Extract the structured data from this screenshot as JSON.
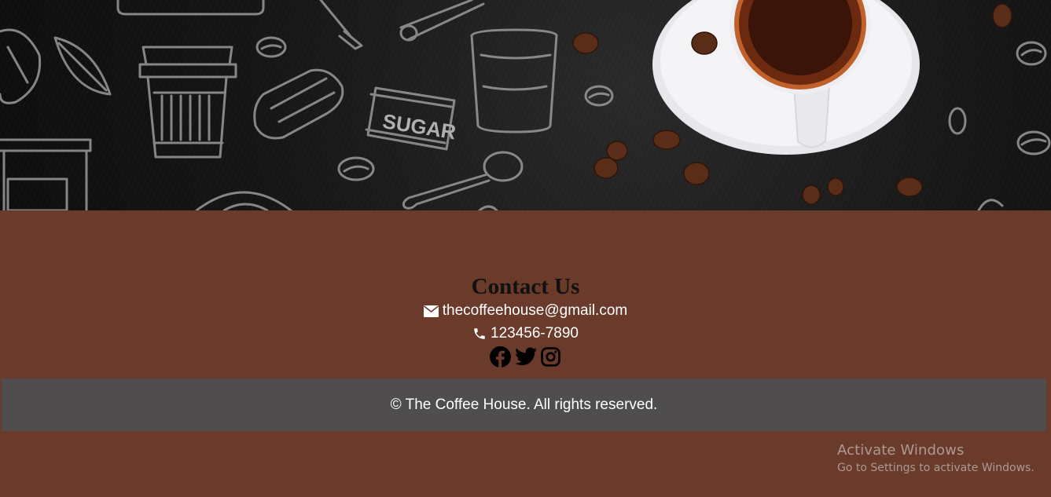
{
  "hero": {
    "image_name": "coffee-doodle-banner",
    "sugar_label": "SUGAR"
  },
  "contact": {
    "title": "Contact Us",
    "email_icon": "envelope-icon",
    "email": "thecoffeehouse@gmail.com",
    "phone_icon": "phone-icon",
    "phone": "123456-7890",
    "socials": [
      {
        "name": "facebook-icon"
      },
      {
        "name": "twitter-icon"
      },
      {
        "name": "instagram-icon"
      }
    ]
  },
  "footer": {
    "copyright": "© The Coffee House. All rights reserved."
  },
  "watermark": {
    "title": "Activate Windows",
    "subtitle": "Go to Settings to activate Windows."
  },
  "colors": {
    "page_bg": "#6a3a2b",
    "footer_bg": "#4f4d4d",
    "title_text": "#111111",
    "contact_text": "#ffffff"
  }
}
